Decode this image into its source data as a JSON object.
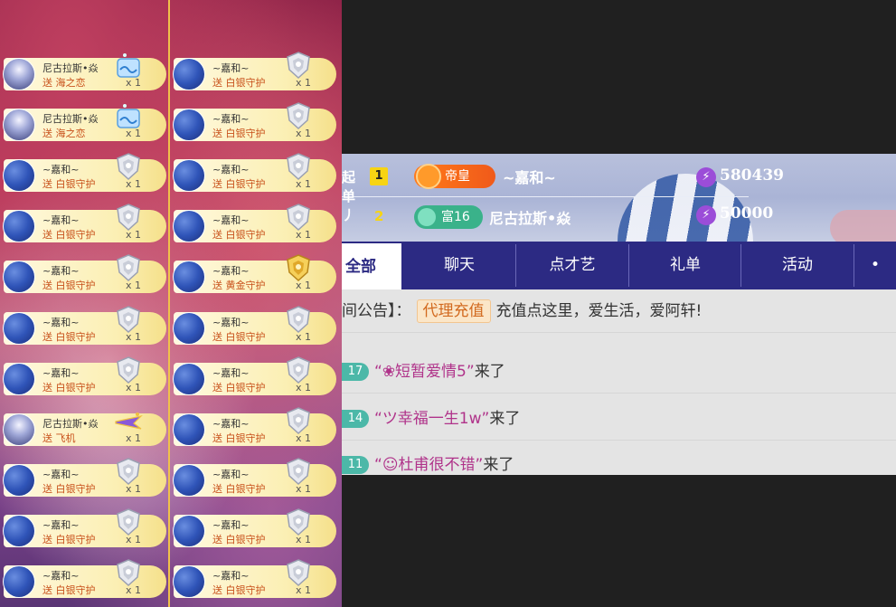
{
  "gift_strip": {
    "left_column": [
      {
        "user": "尼古拉斯•焱",
        "gift": "送 海之恋",
        "count": "x 1",
        "avatar": "nick",
        "icon": "sea-love-gift-icon"
      },
      {
        "user": "尼古拉斯•焱",
        "gift": "送 海之恋",
        "count": "x 1",
        "avatar": "nick",
        "icon": "sea-love-gift-icon"
      },
      {
        "user": "~嘉和~",
        "gift": "送 白银守护",
        "count": "x 1",
        "avatar": "blue",
        "icon": "silver-guard-icon"
      },
      {
        "user": "~嘉和~",
        "gift": "送 白银守护",
        "count": "x 1",
        "avatar": "blue",
        "icon": "silver-guard-icon"
      },
      {
        "user": "~嘉和~",
        "gift": "送 白银守护",
        "count": "x 1",
        "avatar": "blue",
        "icon": "silver-guard-icon"
      },
      {
        "user": "~嘉和~",
        "gift": "送 白银守护",
        "count": "x 1",
        "avatar": "blue",
        "icon": "silver-guard-icon"
      },
      {
        "user": "~嘉和~",
        "gift": "送 白银守护",
        "count": "x 1",
        "avatar": "blue",
        "icon": "silver-guard-icon"
      },
      {
        "user": "尼古拉斯•焱",
        "gift": "送 飞机",
        "count": "x 1",
        "avatar": "nick",
        "icon": "airplane-gift-icon"
      },
      {
        "user": "~嘉和~",
        "gift": "送 白银守护",
        "count": "x 1",
        "avatar": "blue",
        "icon": "silver-guard-icon"
      },
      {
        "user": "~嘉和~",
        "gift": "送 白银守护",
        "count": "x 1",
        "avatar": "blue",
        "icon": "silver-guard-icon"
      },
      {
        "user": "~嘉和~",
        "gift": "送 白银守护",
        "count": "x 1",
        "avatar": "blue",
        "icon": "silver-guard-icon"
      }
    ],
    "right_column": [
      {
        "user": "~嘉和~",
        "gift": "送 白银守护",
        "count": "x 1",
        "avatar": "blue",
        "icon": "silver-guard-icon"
      },
      {
        "user": "~嘉和~",
        "gift": "送 白银守护",
        "count": "x 1",
        "avatar": "blue",
        "icon": "silver-guard-icon"
      },
      {
        "user": "~嘉和~",
        "gift": "送 白银守护",
        "count": "x 1",
        "avatar": "blue",
        "icon": "silver-guard-icon"
      },
      {
        "user": "~嘉和~",
        "gift": "送 白银守护",
        "count": "x 1",
        "avatar": "blue",
        "icon": "silver-guard-icon"
      },
      {
        "user": "~嘉和~",
        "gift": "送 黄金守护",
        "count": "x 1",
        "avatar": "blue",
        "icon": "gold-guard-icon"
      },
      {
        "user": "~嘉和~",
        "gift": "送 白银守护",
        "count": "x 1",
        "avatar": "blue",
        "icon": "silver-guard-icon"
      },
      {
        "user": "~嘉和~",
        "gift": "送 白银守护",
        "count": "x 1",
        "avatar": "blue",
        "icon": "silver-guard-icon"
      },
      {
        "user": "~嘉和~",
        "gift": "送 白银守护",
        "count": "x 1",
        "avatar": "blue",
        "icon": "silver-guard-icon"
      },
      {
        "user": "~嘉和~",
        "gift": "送 白银守护",
        "count": "x 1",
        "avatar": "blue",
        "icon": "silver-guard-icon"
      },
      {
        "user": "~嘉和~",
        "gift": "送 白银守护",
        "count": "x 1",
        "avatar": "blue",
        "icon": "silver-guard-icon"
      },
      {
        "user": "~嘉和~",
        "gift": "送 白银守护",
        "count": "x 1",
        "avatar": "blue",
        "icon": "silver-guard-icon"
      }
    ]
  },
  "ranking": {
    "side_text": "起\n单\n丿",
    "rows": [
      {
        "rank": "1",
        "badge": "帝皇",
        "name": "~嘉和~",
        "score": "580439"
      },
      {
        "rank": "2",
        "badge": "富16",
        "name": "尼古拉斯•焱",
        "score": "50000"
      }
    ]
  },
  "tabs": [
    {
      "label": "全部",
      "active": true
    },
    {
      "label": "聊天",
      "active": false
    },
    {
      "label": "点才艺",
      "active": false
    },
    {
      "label": "礼单",
      "active": false
    },
    {
      "label": "活动",
      "active": false
    }
  ],
  "chat": {
    "notice_prefix": "间公告】：",
    "notice_tag": "代理充值",
    "notice_text": "充值点这里，爱生活，爱阿轩!",
    "messages": [
      {
        "level": "17",
        "quote_open": "“",
        "name": "❀短暂爱情5",
        "quote_close": "”",
        "text": "来了"
      },
      {
        "level": "14",
        "quote_open": "“",
        "name": "ツ幸福一生1w",
        "quote_close": "”",
        "text": "来了"
      },
      {
        "level": "11",
        "quote_open": "“",
        "name": "☺杜甫很不错",
        "quote_close": "”",
        "text": "来了"
      }
    ]
  },
  "colors": {
    "tab_bar": "#2c2a83",
    "gold_divider": "#f0c14a",
    "level_badge": "#4cb8a8",
    "username": "#b0338a"
  }
}
